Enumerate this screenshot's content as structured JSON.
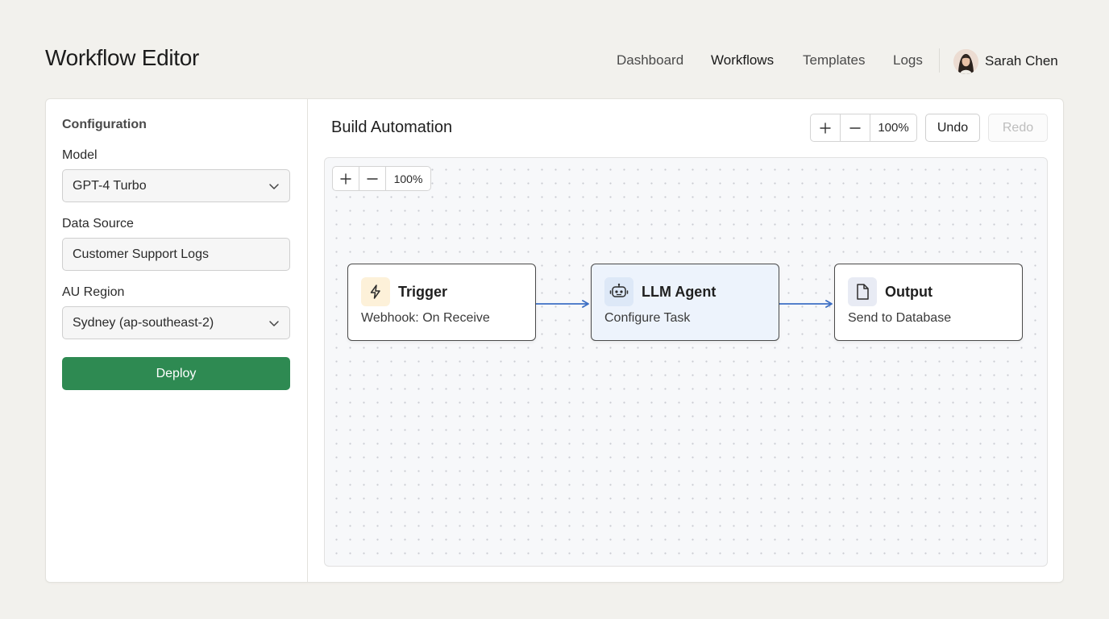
{
  "app": {
    "title": "Workflow Editor"
  },
  "nav": {
    "items": [
      {
        "label": "Dashboard",
        "active": false
      },
      {
        "label": "Workflows",
        "active": true
      },
      {
        "label": "Templates",
        "active": false
      },
      {
        "label": "Logs",
        "active": false
      }
    ],
    "user": {
      "name": "Sarah Chen",
      "avatar_icon": "user-avatar"
    }
  },
  "sidebar": {
    "heading": "Configuration",
    "model": {
      "label": "Model",
      "value": "GPT-4 Turbo"
    },
    "data_source": {
      "label": "Data Source",
      "value": "Customer Support Logs"
    },
    "region": {
      "label": "AU Region",
      "value": "Sydney (ap-southeast-2)"
    },
    "deploy_label": "Deploy"
  },
  "editor": {
    "title": "Build Automation",
    "toolbar": {
      "zoom": "100%",
      "undo_label": "Undo",
      "redo_label": "Redo"
    },
    "canvas": {
      "zoom": "100%",
      "nodes": [
        {
          "title": "Trigger",
          "subtitle": "Webhook: On Receive",
          "icon": "lightning-icon"
        },
        {
          "title": "LLM Agent",
          "subtitle": "Configure Task",
          "icon": "robot-icon"
        },
        {
          "title": "Output",
          "subtitle": "Send to Database",
          "icon": "document-icon"
        }
      ]
    }
  },
  "colors": {
    "accent_green": "#2e8a52",
    "edge_blue": "#3d6fc4",
    "agent_node_bg": "#edf3fc",
    "trigger_icon_bg": "#fdf1d9",
    "agent_icon_bg": "#dde8f7",
    "output_icon_bg": "#e8ebf4"
  }
}
